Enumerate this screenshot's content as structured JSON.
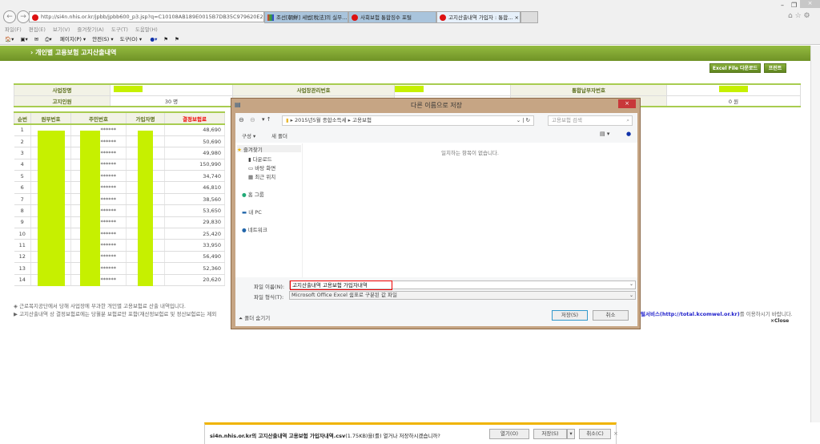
{
  "browser": {
    "url": "http://si4n.nhis.or.kr/jpbb/jpbb600_p3.jsp?q=C10108AB189E0015B7DB35C979620E2!",
    "tabs": [
      {
        "label": "조선[朝鮮] 세법[稅法]의 실무..."
      },
      {
        "label": "사회보험 통합징수 포털"
      },
      {
        "label": "고지산출내역 가입자 : 통합...",
        "active": true
      }
    ],
    "menu": [
      "파일(F)",
      "편집(E)",
      "보기(V)",
      "즐겨찾기(A)",
      "도구(T)",
      "도움말(H)"
    ],
    "toolbar": [
      "페이지(P) ▾",
      "안전(S) ▾",
      "도구(O) ▾"
    ]
  },
  "page": {
    "title": "› 개인별 고용보험 고지산출내역",
    "excel_button": "Excel File 다운로드",
    "print_button": "프린트",
    "info": {
      "l1": "사업장명",
      "l2": "사업장관리번호",
      "l3": "통합납부자번호",
      "l4": "고지인원",
      "v4": "30 명",
      "v6": "0 원"
    },
    "columns": [
      "순번",
      "원부번호",
      "주민번호",
      "가입자명",
      "결정보험료"
    ],
    "rows": [
      [
        "1",
        "48,690"
      ],
      [
        "2",
        "50,690"
      ],
      [
        "3",
        "49,980"
      ],
      [
        "4",
        "150,990"
      ],
      [
        "5",
        "34,740"
      ],
      [
        "6",
        "46,810"
      ],
      [
        "7",
        "38,560"
      ],
      [
        "8",
        "53,650"
      ],
      [
        "9",
        "29,830"
      ],
      [
        "10",
        "25,420"
      ],
      [
        "11",
        "33,950"
      ],
      [
        "12",
        "56,490"
      ],
      [
        "13",
        "52,360"
      ],
      [
        "14",
        "20,620"
      ]
    ],
    "mask": "******",
    "note1": "◈ 근로복지공단에서 당해 사업장에 부과한 개인별 고용보험료 산출 내역입니다.",
    "note2": "▶ 고지산출내역 상 결정보험료에는 당월분 보험료만 포함(재산정보험료 및 정산보험료는 제외",
    "link": "털서비스(http://total.kcomwel.or.kr)",
    "note2_end": "를 이용하시기 바랍니다.",
    "close": "×Close"
  },
  "dialog": {
    "title": "다른 이름으로 저장",
    "path": [
      "2015년5월 종합소득세",
      "고용보험"
    ],
    "search_placeholder": "고용보험 검색",
    "organize": "구성 ▾",
    "new_folder": "새 폴더",
    "empty": "일치하는 항목이 없습니다.",
    "nav": [
      {
        "label": "즐겨찾기"
      },
      {
        "label": "다운로드"
      },
      {
        "label": "바탕 화면"
      },
      {
        "label": "최근 위치"
      },
      {
        "label": "홈 그룹"
      },
      {
        "label": "내 PC"
      },
      {
        "label": "네트워크"
      }
    ],
    "filename_label": "파일 이름(N):",
    "filename": "고지산출내역 고용보험 가입자내역",
    "filetype_label": "파일 형식(T):",
    "filetype": "Microsoft Office Excel 쉼표로 구분된 값 파일",
    "hide_folders": "폴더 숨기기",
    "save": "저장(S)",
    "cancel": "취소"
  },
  "download": {
    "site": "si4n.nhis.or.kr",
    "message": "의 고지산출내역 고용보험 가입자내역.csv",
    "size": "(1.75KB)을(를) 열거나 저장하시겠습니까?",
    "open": "열기(O)",
    "save": "저장(S)",
    "cancel": "취소(C)"
  },
  "colors": {
    "highlight": "#c6f000",
    "green": "#7fa52f",
    "dialog_frame": "#c6a584"
  }
}
